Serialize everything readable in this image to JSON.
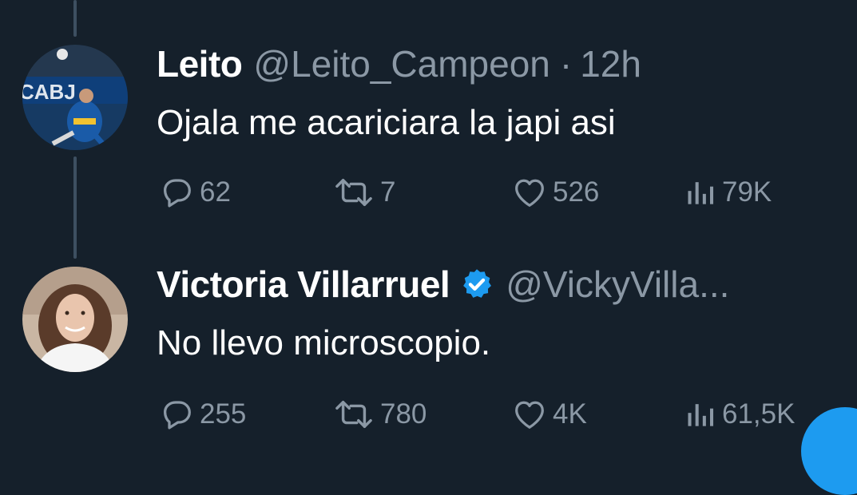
{
  "tweets": [
    {
      "name": "Leito",
      "handle": "@Leito_Campeon",
      "separator": "·",
      "time": "12h",
      "text": "Ojala me acariciara la japi asi",
      "replies": "62",
      "retweets": "7",
      "likes": "526",
      "views": "79K",
      "verified": false,
      "avatar_text": "CABJ"
    },
    {
      "name": "Victoria Villarruel",
      "handle": "@VickyVilla...",
      "text": "No llevo microscopio.",
      "replies": "255",
      "retweets": "780",
      "likes": "4K",
      "views": "61,5K",
      "verified": true
    }
  ],
  "colors": {
    "background": "#15202b",
    "secondary_text": "#8b98a5",
    "verified_badge": "#1d9bf0",
    "thread_line": "#3d4f61"
  },
  "icons": [
    "reply-icon",
    "retweet-icon",
    "like-icon",
    "views-icon",
    "verified-badge-icon"
  ]
}
